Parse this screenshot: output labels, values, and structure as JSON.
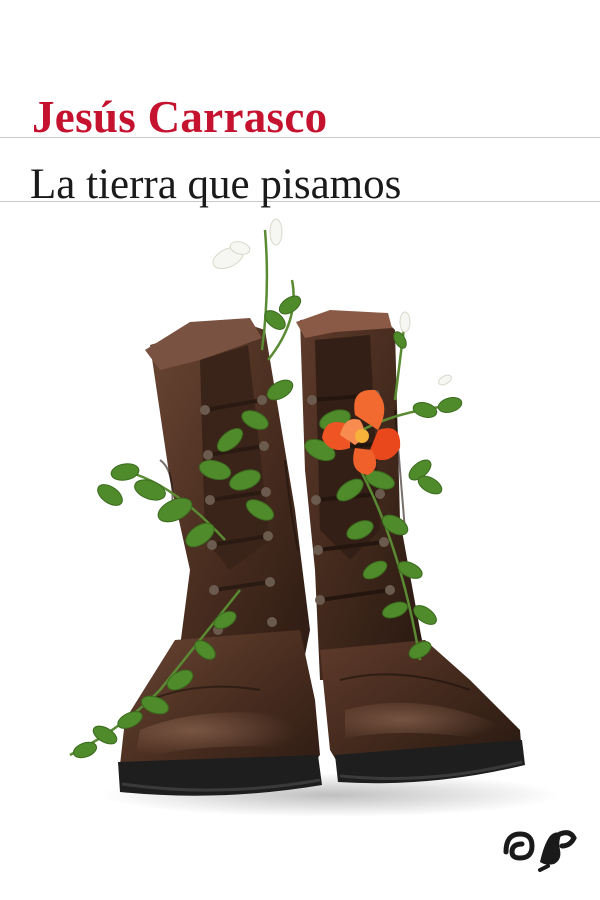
{
  "cover": {
    "author": "Jesús Carrasco",
    "title": "La tierra que pisamos",
    "illustration": "worn-leather-boots-with-plants-and-flower",
    "logo": "epublibre-logo",
    "colors": {
      "author_red": "#c4122f",
      "title_black": "#1a1a1a",
      "leather_brown": "#4a2e1f",
      "leaf_green": "#4f8a2b",
      "flower_orange": "#f05a28"
    }
  }
}
